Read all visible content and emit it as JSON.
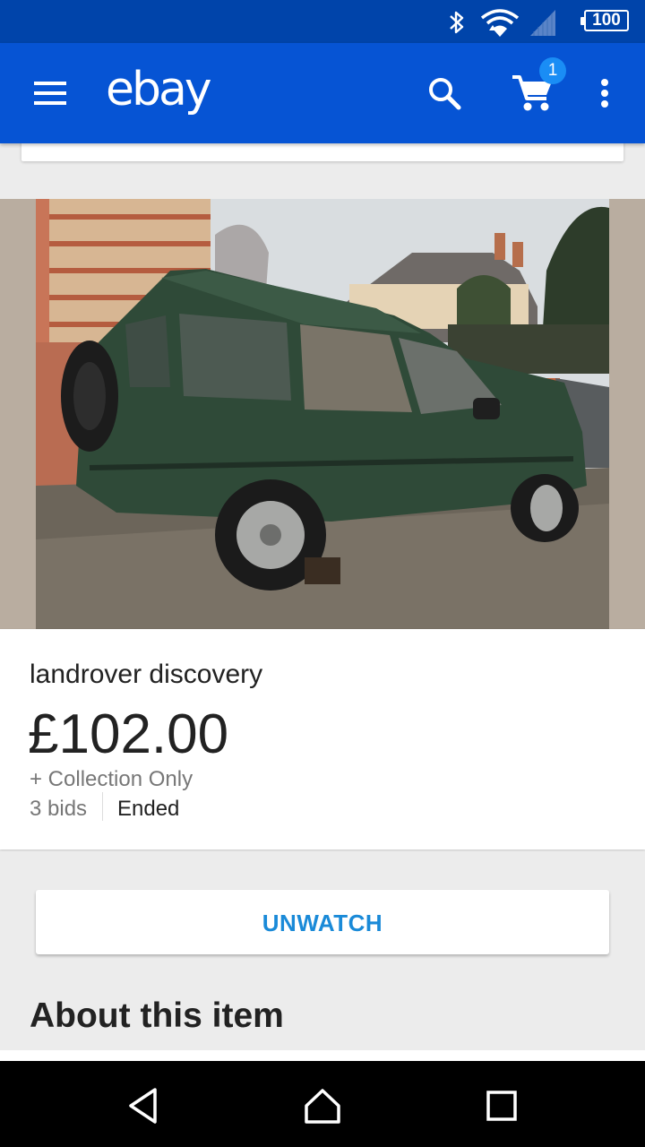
{
  "status_bar": {
    "battery_level": "100",
    "icons": [
      "bluetooth-icon",
      "wifi-icon",
      "signal-icon",
      "battery-icon"
    ]
  },
  "app_bar": {
    "logo": "ebay",
    "cart_count": "1",
    "icons": [
      "menu-icon",
      "search-icon",
      "cart-icon",
      "overflow-menu-icon"
    ]
  },
  "item": {
    "image_desc": "green Land Rover Discovery photo",
    "title": "landrover discovery",
    "price": "£102.00",
    "shipping": "+ Collection Only",
    "bids": "3 bids",
    "status": "Ended"
  },
  "actions": {
    "unwatch_label": "UNWATCH"
  },
  "about": {
    "heading": "About this item"
  },
  "nav_bar": {
    "icons": [
      "back-icon",
      "home-icon",
      "recents-icon"
    ]
  },
  "colors": {
    "status_bar": "#0044aa",
    "app_bar": "#0654d4",
    "badge": "#1a8df5",
    "accent_text": "#1a8ad8",
    "image_background": "#b9ada0"
  }
}
